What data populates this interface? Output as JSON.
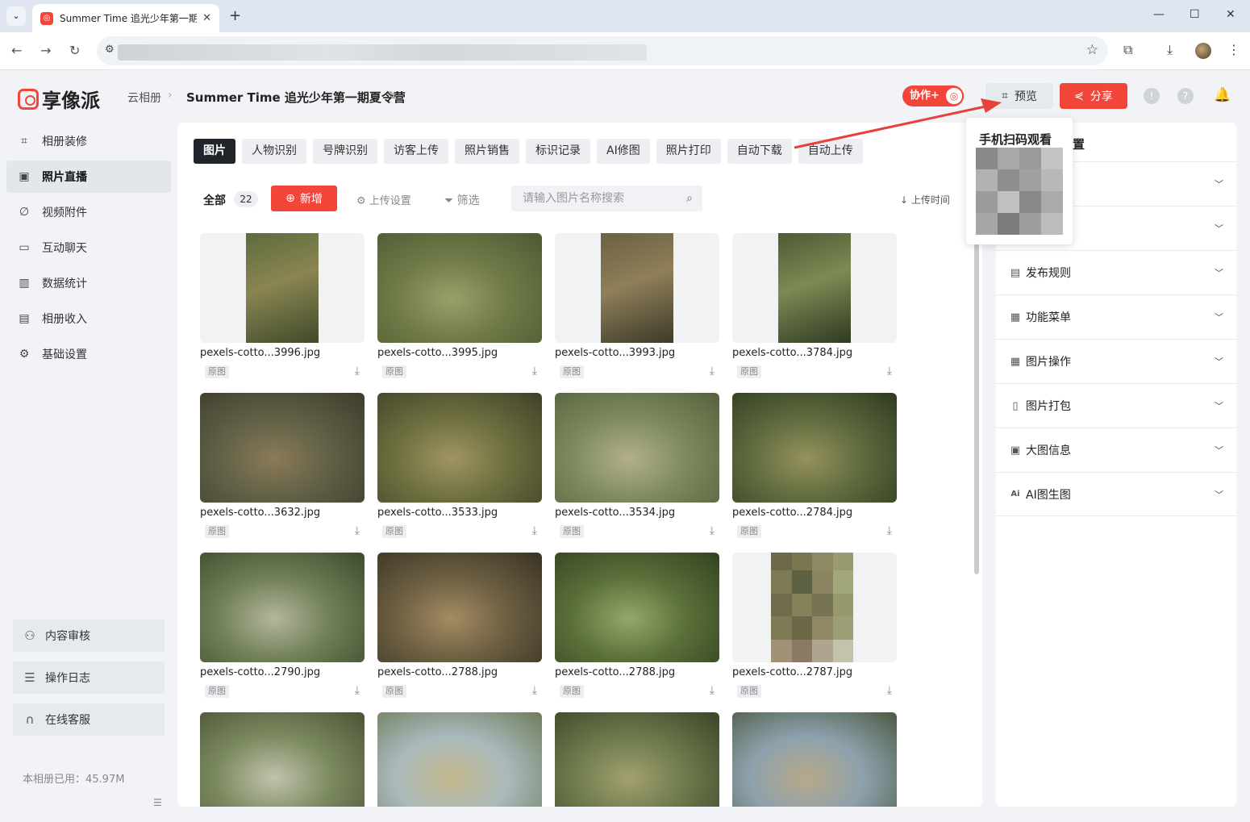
{
  "browser": {
    "tab_title": "Summer Time 追光少年第一期夏令营",
    "new_tab": "+",
    "tab_close": "✕",
    "favicon": "logo-icon"
  },
  "header": {
    "logo_text": "享像派",
    "breadcrumb": "云相册",
    "album_title": "Summer Time 追光少年第一期夏令营",
    "collab_label": "协作+",
    "preview_label": "预览",
    "share_label": "分享"
  },
  "sidebar": {
    "items": [
      {
        "label": "相册装修",
        "icon": "decorate-icon"
      },
      {
        "label": "照片直播",
        "icon": "image-icon",
        "active": true
      },
      {
        "label": "视频附件",
        "icon": "attachment-icon"
      },
      {
        "label": "互动聊天",
        "icon": "chat-icon"
      },
      {
        "label": "数据统计",
        "icon": "stats-icon"
      },
      {
        "label": "相册收入",
        "icon": "income-icon"
      },
      {
        "label": "基础设置",
        "icon": "gear-icon"
      }
    ],
    "bottom": [
      {
        "label": "内容审核",
        "icon": "review-icon"
      },
      {
        "label": "操作日志",
        "icon": "log-icon"
      },
      {
        "label": "在线客服",
        "icon": "headset-icon"
      }
    ],
    "storage": "本相册已用：45.97M"
  },
  "main": {
    "tabs": [
      "图片",
      "人物识别",
      "号牌识别",
      "访客上传",
      "照片销售",
      "标识记录",
      "AI修图",
      "照片打印",
      "自动下载",
      "自动上传"
    ],
    "all_label": "全部",
    "count": "22",
    "add_label": "新增",
    "upload_settings": "上传设置",
    "filter": "筛选",
    "search_placeholder": "请输入图片名称搜索",
    "sort_label": "上传时间",
    "orig_label": "原图",
    "photos": [
      {
        "name": "pexels-cotto...3996.jpg"
      },
      {
        "name": "pexels-cotto...3995.jpg"
      },
      {
        "name": "pexels-cotto...3993.jpg"
      },
      {
        "name": "pexels-cotto...3784.jpg"
      },
      {
        "name": "pexels-cotto...3632.jpg"
      },
      {
        "name": "pexels-cotto...3533.jpg"
      },
      {
        "name": "pexels-cotto...3534.jpg"
      },
      {
        "name": "pexels-cotto...2784.jpg"
      },
      {
        "name": "pexels-cotto...2790.jpg"
      },
      {
        "name": "pexels-cotto...2788.jpg"
      },
      {
        "name": "pexels-cotto...2788.jpg"
      },
      {
        "name": "pexels-cotto...2787.jpg"
      },
      {
        "name": ""
      },
      {
        "name": ""
      },
      {
        "name": ""
      },
      {
        "name": ""
      }
    ]
  },
  "right_panel": {
    "title_partial": "置",
    "rows": [
      {
        "label": "",
        "icon": ""
      },
      {
        "label": "",
        "icon": ""
      },
      {
        "label": "发布规则",
        "icon": "rules-icon"
      },
      {
        "label": "功能菜单",
        "icon": "menu-grid-icon"
      },
      {
        "label": "图片操作",
        "icon": "grid-icon"
      },
      {
        "label": "图片打包",
        "icon": "package-icon"
      },
      {
        "label": "大图信息",
        "icon": "image-info-icon"
      },
      {
        "label": "AI图生图",
        "icon": "ai-icon"
      }
    ]
  },
  "popover": {
    "title": "手机扫码观看"
  },
  "colors": {
    "accent": "#f2463b",
    "annotation_arrow": "#e8403a"
  }
}
